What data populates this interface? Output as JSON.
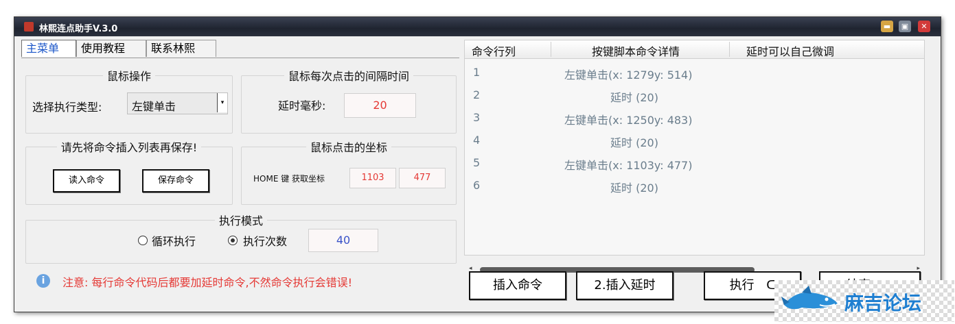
{
  "window": {
    "title": "林熙连点助手V.3.0",
    "title_icon": "app-logo-icon",
    "buttons": {
      "minimize": "▬",
      "restore": "▣",
      "close": "✕"
    }
  },
  "tabs": [
    {
      "label": "主菜单",
      "active": true
    },
    {
      "label": "使用教程",
      "active": false
    },
    {
      "label": "联系林熙",
      "active": false
    }
  ],
  "mouse_op": {
    "legend": "鼠标操作",
    "type_label": "选择执行类型:",
    "type_value": "左键单击"
  },
  "interval": {
    "legend": "鼠标每次点击的间隔时间",
    "delay_label": "延时毫秒:",
    "delay_value": "20"
  },
  "commands_group": {
    "legend": "请先将命令插入列表再保存!",
    "read_button": "读入命令",
    "save_button": "保存命令"
  },
  "coords": {
    "legend": "鼠标点击的坐标",
    "hint": "HOME 键 获取坐标",
    "x": "1103",
    "y": "477"
  },
  "exec_mode": {
    "legend": "执行模式",
    "loop_label": "循环执行",
    "count_label": "执行次数",
    "count_value": "40",
    "selected": "count"
  },
  "notice": {
    "icon": "info-icon",
    "text": "注意:  每行命令代码后都要加延时命令,不然命令执行会错误!"
  },
  "list": {
    "headers": [
      "命令行列",
      "按键脚本命令详情",
      "延时可以自己微调"
    ],
    "rows": [
      {
        "index": "1",
        "command": "左键单击(x: 1279y: 514)"
      },
      {
        "index": "2",
        "command": "延时 (20)"
      },
      {
        "index": "3",
        "command": "左键单击(x: 1250y: 483)"
      },
      {
        "index": "4",
        "command": "延时 (20)"
      },
      {
        "index": "5",
        "command": "左键单击(x: 1103y: 477)"
      },
      {
        "index": "6",
        "command": "延时 (20)"
      }
    ]
  },
  "actions": {
    "insert_command": "插入命令",
    "insert_delay": "2.插入延时",
    "execute": "执行",
    "execute_suffix": "ᑕ",
    "end": "结束",
    "end_suffix": "D"
  },
  "watermark": {
    "text": "麻吉论坛",
    "icon": "shark-logo-icon"
  },
  "colors": {
    "accent_red": "#e53935",
    "tab_active": "#1a55c8",
    "list_text": "#6a7d8c",
    "count_text": "#3a52c8"
  }
}
